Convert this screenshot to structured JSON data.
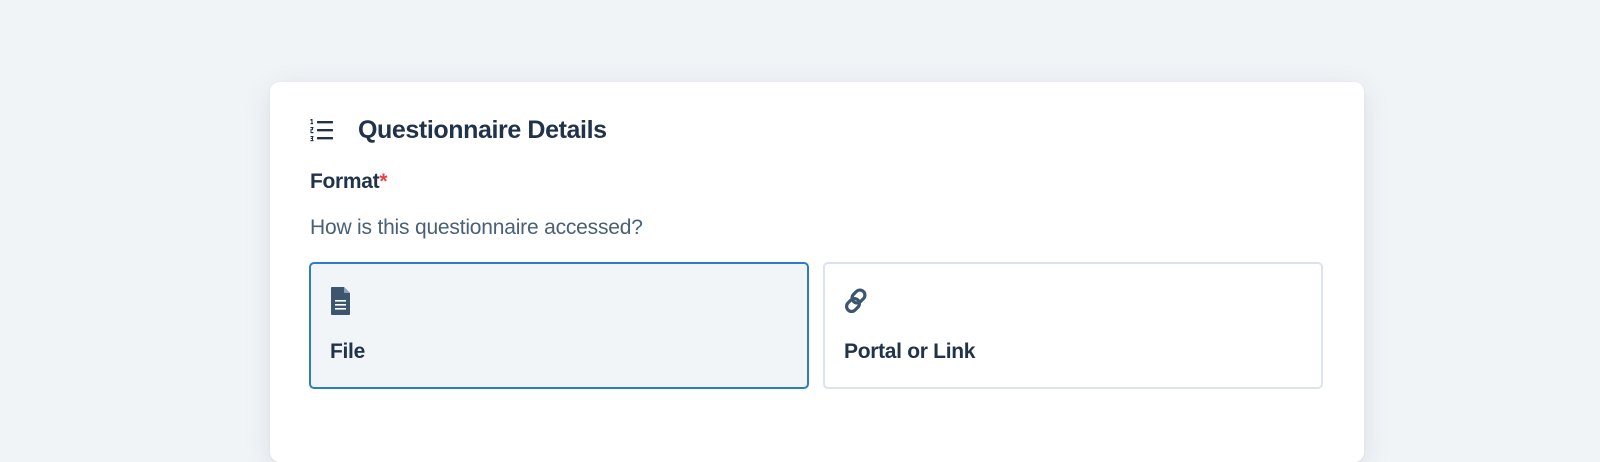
{
  "section": {
    "icon": "numbered-list-icon",
    "title": "Questionnaire Details"
  },
  "format_field": {
    "label": "Format",
    "required_marker": "*",
    "help_text": "How is this questionnaire accessed?",
    "selected": "File",
    "options": [
      {
        "label": "File",
        "icon": "file-document-icon",
        "selected": true
      },
      {
        "label": "Portal or Link",
        "icon": "link-icon",
        "selected": false
      }
    ]
  },
  "colors": {
    "background": "#f1f4f7",
    "card": "#ffffff",
    "text_primary": "#20334a",
    "text_secondary": "#496077",
    "required": "#e0454f",
    "selected_border": "#2e7cc9",
    "selected_fill": "#f1f5f8",
    "unselected_border": "#dbe3ec",
    "icon": "#3d5670"
  }
}
